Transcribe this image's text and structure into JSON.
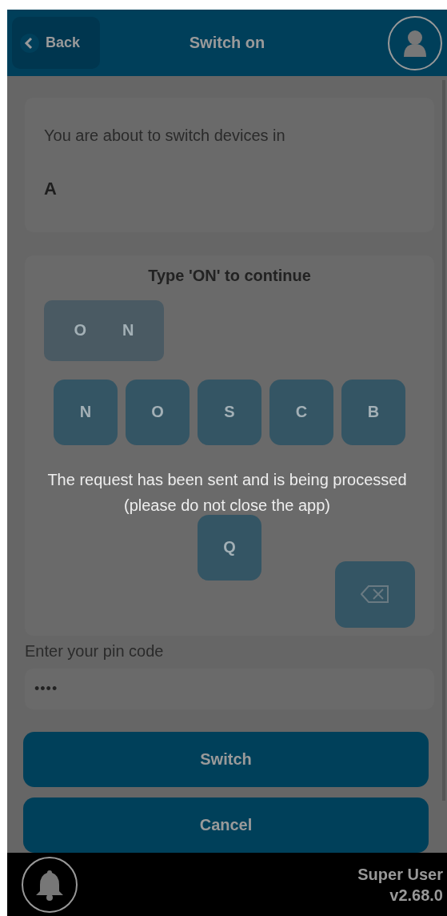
{
  "header": {
    "back": "Back",
    "title": "Switch on"
  },
  "info": {
    "text": "You are about to switch devices in",
    "value": "A"
  },
  "keyboard": {
    "prompt": "Type 'ON' to continue",
    "entered": [
      "O",
      "N"
    ],
    "key_rows": [
      [
        "N",
        "O",
        "S",
        "C",
        "B"
      ],
      [
        "Q"
      ]
    ]
  },
  "pin": {
    "label": "Enter your pin code",
    "value": "••••"
  },
  "buttons": [
    "Switch",
    "Cancel"
  ],
  "footer": {
    "user": "Super User",
    "version": "v2.68.0"
  },
  "overlay": {
    "lines": [
      "The request has been sent and is being processed",
      "(please do not close the app)"
    ]
  }
}
